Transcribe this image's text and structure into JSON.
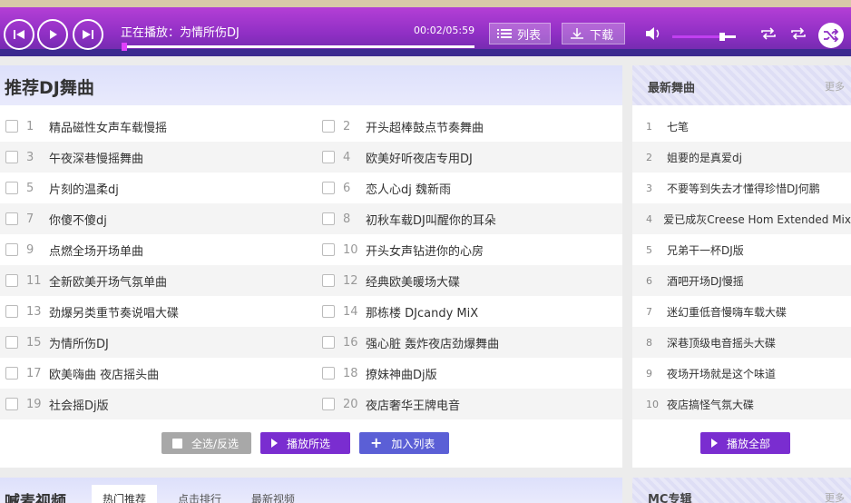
{
  "player": {
    "now_playing": "正在播放：为情所伤DJ",
    "time": "00:02/05:59",
    "progress_fraction": 0.0,
    "list_label": "列表",
    "download_label": "下载",
    "volume_fraction": 0.78
  },
  "recommend": {
    "title": "推荐DJ舞曲",
    "left_items": [
      {
        "num": "1",
        "title": "精品磁性女声车载慢摇"
      },
      {
        "num": "3",
        "title": "午夜深巷慢摇舞曲"
      },
      {
        "num": "5",
        "title": "片刻的温柔dj"
      },
      {
        "num": "7",
        "title": "你傻不傻dj"
      },
      {
        "num": "9",
        "title": "点燃全场开场单曲"
      },
      {
        "num": "11",
        "title": "全新欧美开场气氛单曲"
      },
      {
        "num": "13",
        "title": "劲爆另类重节奏说唱大碟"
      },
      {
        "num": "15",
        "title": "为情所伤DJ"
      },
      {
        "num": "17",
        "title": "欧美嗨曲 夜店摇头曲"
      },
      {
        "num": "19",
        "title": "社会摇Dj版"
      }
    ],
    "right_items": [
      {
        "num": "2",
        "title": "开头超棒鼓点节奏舞曲"
      },
      {
        "num": "4",
        "title": "欧美好听夜店专用DJ"
      },
      {
        "num": "6",
        "title": "恋人心dj 魏新雨"
      },
      {
        "num": "8",
        "title": "初秋车载DJ叫醒你的耳朵"
      },
      {
        "num": "10",
        "title": "开头女声钻进你的心房"
      },
      {
        "num": "12",
        "title": "经典欧美暖场大碟"
      },
      {
        "num": "14",
        "title": "那栋楼 DJcandy MiX"
      },
      {
        "num": "16",
        "title": "强心脏 轰炸夜店劲爆舞曲"
      },
      {
        "num": "18",
        "title": "撩妹神曲Dj版"
      },
      {
        "num": "20",
        "title": "夜店奢华王牌电音"
      }
    ],
    "select_all_label": "全选/反选",
    "play_selected_label": "播放所选",
    "add_list_label": "加入列表"
  },
  "latest": {
    "title": "最新舞曲",
    "more": "更多",
    "items": [
      {
        "num": "1",
        "title": "七笔"
      },
      {
        "num": "2",
        "title": "姐要的是真爱dj"
      },
      {
        "num": "3",
        "title": "不要等到失去才懂得珍惜DJ何鹏"
      },
      {
        "num": "4",
        "title": "爱已成灰Creese Hom Extended Mix"
      },
      {
        "num": "5",
        "title": "兄弟干一杯DJ版"
      },
      {
        "num": "6",
        "title": "酒吧开场DJ慢摇"
      },
      {
        "num": "7",
        "title": "迷幻重低音慢嗨车载大碟"
      },
      {
        "num": "8",
        "title": "深巷顶级电音摇头大碟"
      },
      {
        "num": "9",
        "title": "夜场开场就是这个味道"
      },
      {
        "num": "10",
        "title": "夜店搞怪气氛大碟"
      }
    ],
    "play_all_label": "播放全部"
  },
  "video": {
    "title": "喊麦视频",
    "tabs": [
      "热门推荐",
      "点击排行",
      "最新视频"
    ]
  },
  "mc": {
    "title": "MC专辑",
    "more": "更多"
  },
  "colors": {
    "player_purple": "#8f2fc4",
    "button_purple": "#7a2dd0",
    "button_blue": "#5b5fd6",
    "button_gray": "#a8a8a8"
  }
}
